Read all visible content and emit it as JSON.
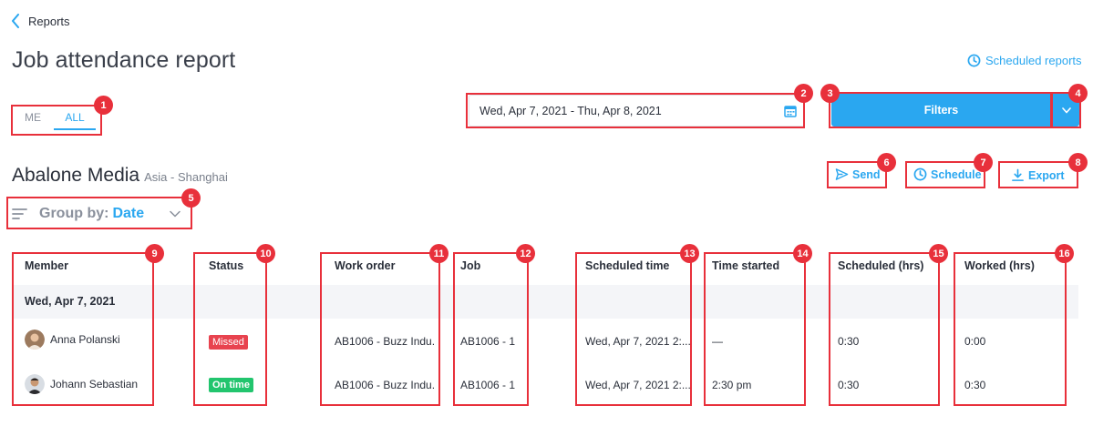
{
  "breadcrumb": {
    "back_label": "Reports"
  },
  "page": {
    "title": "Job attendance report"
  },
  "header": {
    "scheduled_reports_label": "Scheduled reports"
  },
  "toggle": {
    "me_label": "ME",
    "all_label": "ALL",
    "selected": "ALL"
  },
  "date_range": {
    "value": "Wed, Apr 7, 2021 - Thu, Apr 8, 2021"
  },
  "filters": {
    "label": "Filters"
  },
  "organization": {
    "name": "Abalone Media",
    "timezone": "Asia - Shanghai"
  },
  "actions": {
    "send_label": "Send",
    "schedule_label": "Schedule",
    "export_label": "Export"
  },
  "group_by": {
    "label": "Group by:",
    "value": "Date"
  },
  "table": {
    "columns": [
      "Member",
      "Status",
      "Work order",
      "Job",
      "Scheduled time",
      "Time started",
      "Scheduled (hrs)",
      "Worked (hrs)"
    ],
    "group_label": "Wed, Apr 7, 2021",
    "rows": [
      {
        "member": "Anna Polanski",
        "status": "Missed",
        "work_order": "AB1006 - Buzz Indu...",
        "job": "AB1006 - 1",
        "scheduled_time": "Wed, Apr 7, 2021 2:...",
        "time_started": "—",
        "scheduled_hrs": "0:30",
        "worked_hrs": "0:00"
      },
      {
        "member": "Johann Sebastian",
        "status": "On time",
        "work_order": "AB1006 - Buzz Indu...",
        "job": "AB1006 - 1",
        "scheduled_time": "Wed, Apr 7, 2021 2:...",
        "time_started": "2:30 pm",
        "scheduled_hrs": "0:30",
        "worked_hrs": "0:30"
      }
    ]
  },
  "annotations": [
    "1",
    "2",
    "3",
    "4",
    "5",
    "6",
    "7",
    "8",
    "9",
    "10",
    "11",
    "12",
    "13",
    "14",
    "15",
    "16"
  ],
  "colors": {
    "accent": "#2aa7f0",
    "annotation": "#e8303b",
    "missed": "#e8434f",
    "on_time": "#22c56e",
    "group_row": "#f4f5f8"
  }
}
